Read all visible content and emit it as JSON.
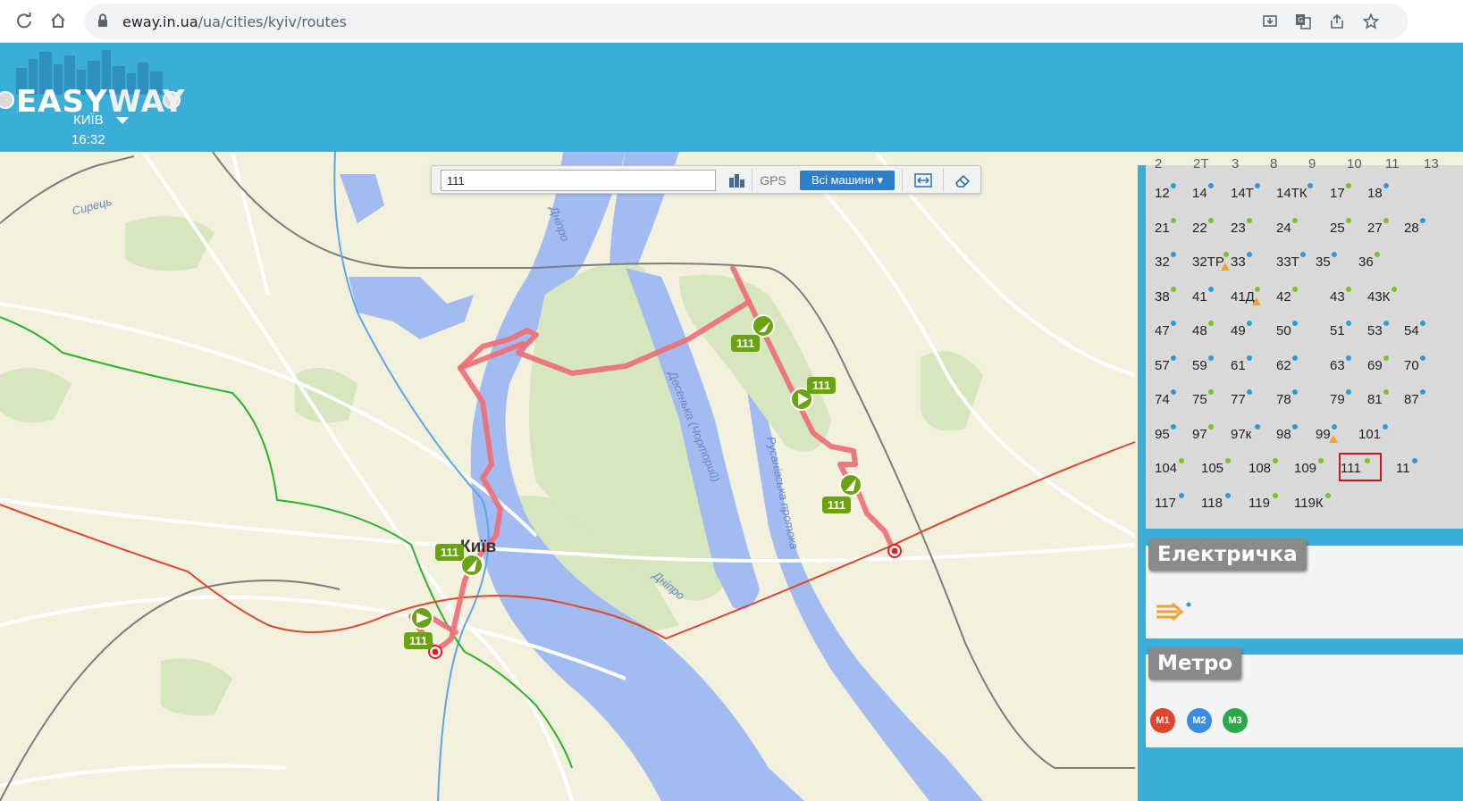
{
  "browser": {
    "url_host": "eway.in.ua",
    "url_path": "/ua/cities/kyiv/routes"
  },
  "header": {
    "logo_easy": "EASY",
    "logo_way": "WAY",
    "city": "КИЇВ",
    "time": "16:32"
  },
  "toolbar": {
    "search_value": "111",
    "gps_label": "GPS",
    "vehicles_label": "Всі машини ▾"
  },
  "map": {
    "city_label": "Київ",
    "labels": [
      "Сирець",
      "Дніпро",
      "Десенька (Чорторий)",
      "Русанівська протока",
      "Дніпро"
    ],
    "bus_label": "111"
  },
  "routes_panel": {
    "partial_row": [
      "2",
      "2Т",
      "3",
      "8",
      "9",
      "10",
      "11",
      "13"
    ],
    "rows": [
      [
        {
          "n": "12",
          "c": "b"
        },
        {
          "n": "14",
          "c": "b"
        },
        {
          "n": "14Т",
          "c": "b"
        },
        {
          "n": "14ТК",
          "c": "b"
        },
        {
          "n": "17",
          "c": "g"
        },
        {
          "n": "18",
          "c": "b"
        }
      ],
      [
        {
          "n": "21",
          "c": "g"
        },
        {
          "n": "22",
          "c": "g"
        },
        {
          "n": "23",
          "c": "g"
        },
        {
          "n": "24",
          "c": "g"
        },
        {
          "n": "25",
          "c": "g"
        },
        {
          "n": "27",
          "c": "g"
        },
        {
          "n": "28",
          "c": "b"
        }
      ],
      [
        {
          "n": "32",
          "c": "b"
        },
        {
          "n": "32ТР",
          "c": "g",
          "warn": true
        },
        {
          "n": "33",
          "c": "b"
        },
        {
          "n": "33Т",
          "c": "b"
        },
        {
          "n": "35",
          "c": "b"
        },
        {
          "n": "36",
          "c": "g"
        }
      ],
      [
        {
          "n": "38",
          "c": "g"
        },
        {
          "n": "41",
          "c": "b"
        },
        {
          "n": "41Д",
          "c": "g",
          "warn": true
        },
        {
          "n": "42",
          "c": "g"
        },
        {
          "n": "43",
          "c": "g"
        },
        {
          "n": "43К",
          "c": "g"
        }
      ],
      [
        {
          "n": "47",
          "c": "b"
        },
        {
          "n": "48",
          "c": "g"
        },
        {
          "n": "49",
          "c": "b"
        },
        {
          "n": "50",
          "c": "b"
        },
        {
          "n": "51",
          "c": "b"
        },
        {
          "n": "53",
          "c": "b"
        },
        {
          "n": "54",
          "c": "b"
        }
      ],
      [
        {
          "n": "57",
          "c": "b"
        },
        {
          "n": "59",
          "c": "b"
        },
        {
          "n": "61",
          "c": "b"
        },
        {
          "n": "62",
          "c": "b"
        },
        {
          "n": "63",
          "c": "b"
        },
        {
          "n": "69",
          "c": "g"
        },
        {
          "n": "70",
          "c": "b"
        }
      ],
      [
        {
          "n": "74",
          "c": "b"
        },
        {
          "n": "75",
          "c": "g"
        },
        {
          "n": "77",
          "c": "b"
        },
        {
          "n": "78",
          "c": "b"
        },
        {
          "n": "79",
          "c": "b"
        },
        {
          "n": "81",
          "c": "g"
        },
        {
          "n": "87",
          "c": "b"
        }
      ],
      [
        {
          "n": "95",
          "c": "b"
        },
        {
          "n": "97",
          "c": "g"
        },
        {
          "n": "97к",
          "c": "b"
        },
        {
          "n": "98",
          "c": "b"
        },
        {
          "n": "99",
          "c": "b",
          "warn": true
        },
        {
          "n": "101",
          "c": "b"
        }
      ],
      [
        {
          "n": "104",
          "c": "g"
        },
        {
          "n": "105",
          "c": "g"
        },
        {
          "n": "108",
          "c": "g"
        },
        {
          "n": "109",
          "c": "g"
        },
        {
          "n": "111",
          "c": "g"
        },
        {
          "n": "11",
          "c": "b"
        }
      ],
      [
        {
          "n": "117",
          "c": "b"
        },
        {
          "n": "118",
          "c": "b"
        },
        {
          "n": "119",
          "c": "g"
        },
        {
          "n": "119К",
          "c": "g"
        }
      ]
    ],
    "selected_route": "111"
  },
  "sections": {
    "train_title": "Електричка",
    "metro_title": "Метро",
    "metro_lines": [
      {
        "label": "M1",
        "color": "#e0442d"
      },
      {
        "label": "M2",
        "color": "#3b8be4"
      },
      {
        "label": "M3",
        "color": "#2ba84a"
      }
    ]
  },
  "colors": {
    "header_blue": "#3aaed8",
    "route_red": "#ef6b73",
    "bus_green": "#6aa30f",
    "water": "#a2bcf2"
  }
}
